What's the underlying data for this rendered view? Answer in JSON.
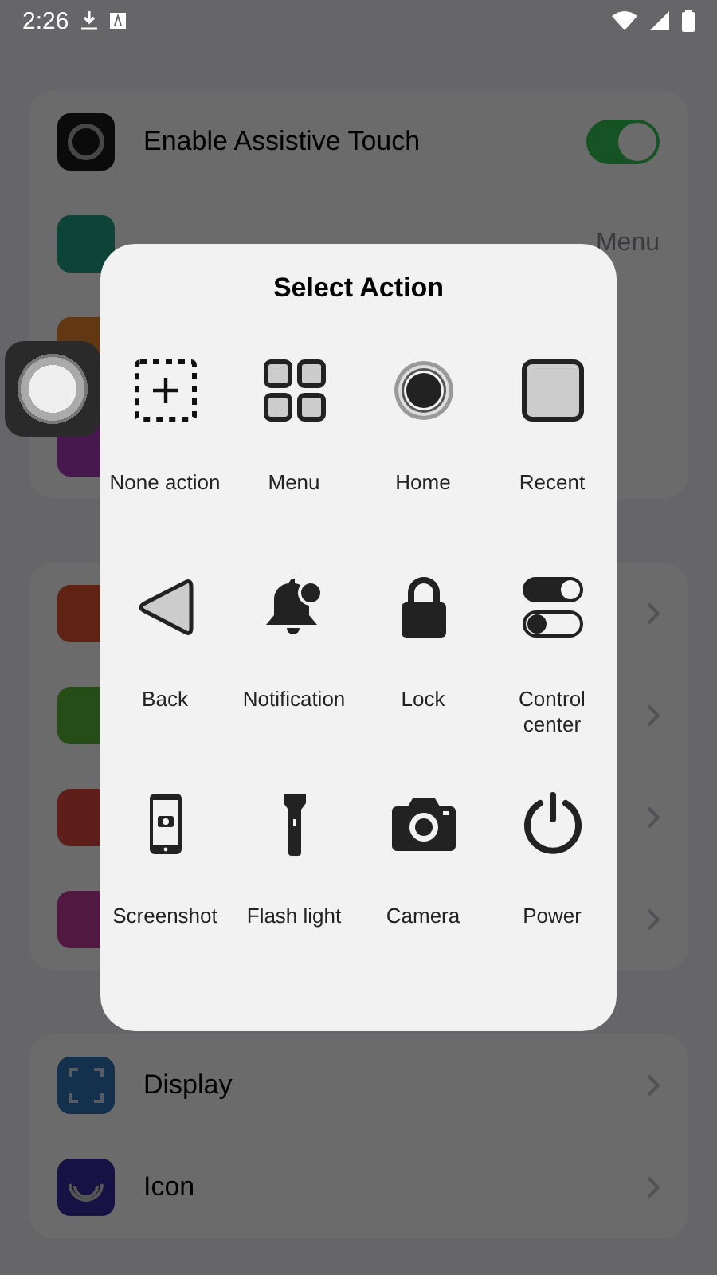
{
  "status_bar": {
    "time": "2:26"
  },
  "sections": [
    {
      "rows": [
        {
          "kind": "toggle",
          "label": "Enable Assistive Touch",
          "on": true
        },
        {
          "kind": "value",
          "value": "Menu"
        },
        {
          "kind": "plain"
        },
        {
          "kind": "plain"
        }
      ]
    },
    {
      "rows": [
        {
          "kind": "chevron"
        },
        {
          "kind": "chevron"
        },
        {
          "kind": "chevron"
        },
        {
          "kind": "chevron"
        }
      ]
    },
    {
      "rows": [
        {
          "kind": "chevron",
          "label": "Display"
        },
        {
          "kind": "chevron",
          "label": "Icon"
        }
      ]
    }
  ],
  "dialog": {
    "title": "Select Action",
    "actions": [
      {
        "kind": "none",
        "label": "None action"
      },
      {
        "kind": "menu",
        "label": "Menu"
      },
      {
        "kind": "home",
        "label": "Home"
      },
      {
        "kind": "recent",
        "label": "Recent"
      },
      {
        "kind": "back",
        "label": "Back"
      },
      {
        "kind": "notification",
        "label": "Notification"
      },
      {
        "kind": "lock",
        "label": "Lock"
      },
      {
        "kind": "control",
        "label": "Control center"
      },
      {
        "kind": "screenshot",
        "label": "Screenshot"
      },
      {
        "kind": "flashlight",
        "label": "Flash light"
      },
      {
        "kind": "camera",
        "label": "Camera"
      },
      {
        "kind": "power",
        "label": "Power"
      }
    ]
  }
}
